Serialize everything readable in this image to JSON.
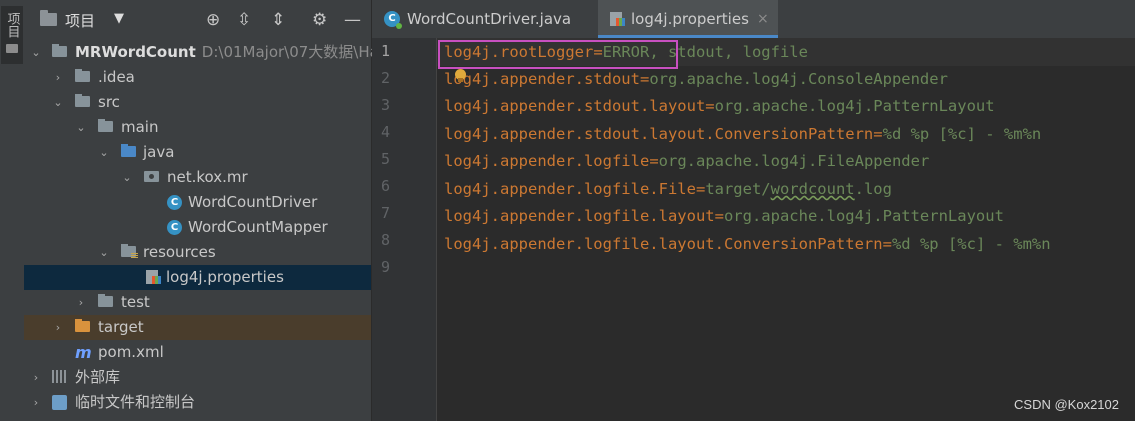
{
  "sidebar": {
    "label": "项目"
  },
  "project_toolbar": {
    "title": "项目",
    "caret": "▼",
    "icons": [
      "target-icon",
      "expand-all-icon",
      "collapse-all-icon",
      "gear-icon",
      "minimize-icon"
    ]
  },
  "tree": {
    "root": {
      "name": "MRWordCount",
      "path": "D:\\01Major\\07大数据\\Ha"
    },
    "idea": ".idea",
    "src": "src",
    "main": "main",
    "java": "java",
    "pkg": "net.kox.mr",
    "driver": "WordCountDriver",
    "mapper": "WordCountMapper",
    "resources": "resources",
    "props": "log4j.properties",
    "test": "test",
    "target": "target",
    "pom": "pom.xml",
    "ext_libs": "外部库",
    "scratches": "临时文件和控制台"
  },
  "tabs": [
    {
      "label": "WordCountDriver.java",
      "icon": "java-class-icon"
    },
    {
      "label": "log4j.properties",
      "icon": "properties-file-icon",
      "close": "×"
    }
  ],
  "line_numbers": [
    "1",
    "2",
    "3",
    "4",
    "5",
    "6",
    "7",
    "8",
    "9"
  ],
  "code": [
    {
      "key": "log4j.rootLogger",
      "sep": "=",
      "val": "ERROR, stdout, logfile"
    },
    {
      "key": "log4j.appender.stdout",
      "sep": "=",
      "val": "org.apache.log4j.ConsoleAppender"
    },
    {
      "key": "log4j.appender.stdout.layout",
      "sep": "=",
      "val": "org.apache.log4j.PatternLayout"
    },
    {
      "key": "log4j.appender.stdout.layout.ConversionPattern",
      "sep": "=",
      "val": "%d %p [%c] - %m%n"
    },
    {
      "key": "log4j.appender.logfile",
      "sep": "=",
      "val": "org.apache.log4j.FileAppender"
    },
    {
      "key": "log4j.appender.logfile.File",
      "sep": "=",
      "val_a": "target/",
      "val_b": "wordcount",
      "val_c": ".log"
    },
    {
      "key": "log4j.appender.logfile.layout",
      "sep": "=",
      "val": "org.apache.log4j.PatternLayout"
    },
    {
      "key": "log4j.appender.logfile.layout.ConversionPattern",
      "sep": "=",
      "val": "%d %p [%c] - %m%n"
    }
  ],
  "watermark": "CSDN @Kox2102",
  "colors": {
    "key": "#cc7832",
    "value": "#6a8759",
    "highlight_box": "#c850c0",
    "tab_accent": "#4a88c7"
  }
}
